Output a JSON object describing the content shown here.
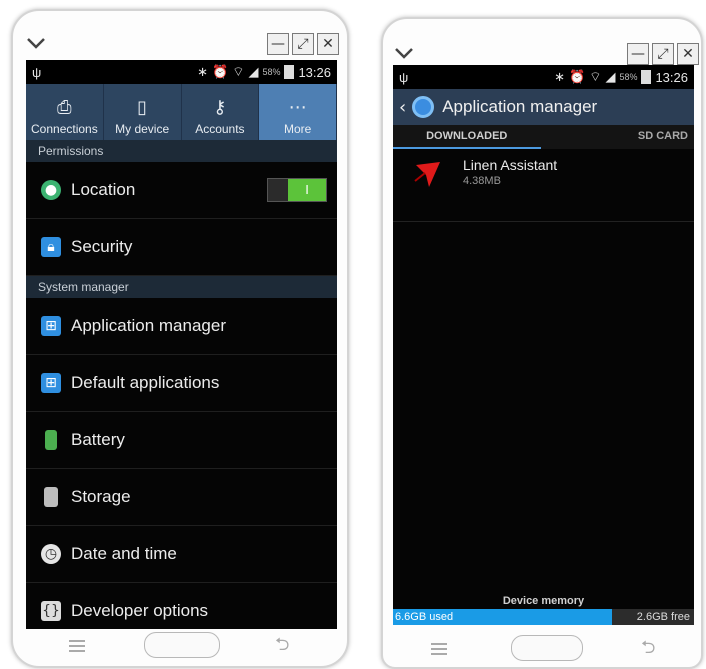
{
  "left_phone": {
    "status": {
      "usb": "ψ",
      "battery_pct": "58%",
      "time": "13:26"
    },
    "tabs": [
      {
        "label": "Connections",
        "icon": "connections-icon"
      },
      {
        "label": "My device",
        "icon": "device-icon"
      },
      {
        "label": "Accounts",
        "icon": "key-icon"
      },
      {
        "label": "More",
        "icon": "more-icon",
        "active": true
      }
    ],
    "sections": {
      "permissions": "Permissions",
      "system": "System manager"
    },
    "items": {
      "location": "Location",
      "toggle_on": "I",
      "security": "Security",
      "app_manager": "Application manager",
      "default_apps": "Default applications",
      "battery": "Battery",
      "storage": "Storage",
      "date_time": "Date and time",
      "developer": "Developer options"
    }
  },
  "right_phone": {
    "status": {
      "usb": "ψ",
      "battery_pct": "58%",
      "time": "13:26"
    },
    "header": "Application manager",
    "tabs": {
      "downloaded": "DOWNLOADED",
      "sd": "SD CARD"
    },
    "apps": [
      {
        "name": "Linen Assistant",
        "size": "4.38MB"
      }
    ],
    "memory": {
      "label": "Device memory",
      "used": "6.6GB used",
      "free": "2.6GB free",
      "used_fraction": 0.72
    }
  },
  "colors": {
    "tab_active": "#4e7fb3",
    "header": "#2c3e55",
    "toggle": "#5cc33a",
    "accent": "#1a9be6"
  }
}
